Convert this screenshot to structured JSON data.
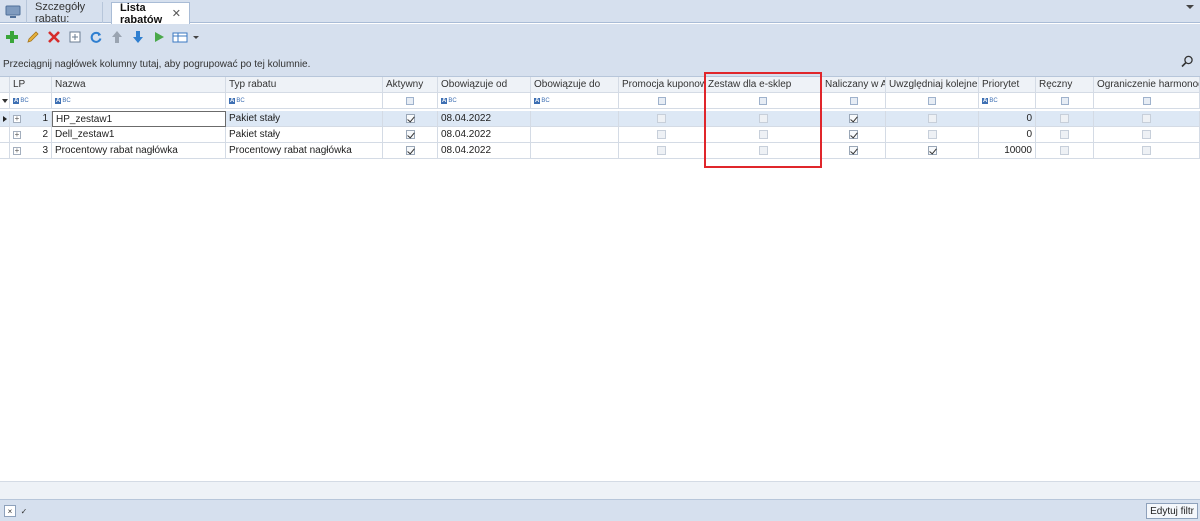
{
  "tabs": [
    {
      "label": "Szczegóły rabatu:",
      "active": false
    },
    {
      "label": "Lista rabatów",
      "active": true,
      "closable": true
    }
  ],
  "toolbar": {
    "icons": [
      "add-icon",
      "edit-icon",
      "delete-icon",
      "document-icon",
      "refresh-icon",
      "move-up-icon",
      "move-down-icon",
      "play-icon",
      "grid-options-icon"
    ]
  },
  "grouppanel": {
    "hint": "Przeciągnij nagłówek kolumny tutaj, aby pogrupować po tej kolumnie."
  },
  "grid": {
    "columns": {
      "lp": "LP",
      "nazwa": "Nazwa",
      "typ": "Typ rabatu",
      "aktywny": "Aktywny",
      "od": "Obowiązuje od",
      "do": "Obowiązuje do",
      "promo": "Promocja kuponowa",
      "zestaw": "Zestaw dla e-sklep",
      "naliczany": "Naliczany w Al...",
      "uwzgl": "Uwzględniaj kolejne r...",
      "priorytet": "Priorytet",
      "reczny": "Ręczny",
      "ogr": "Ograniczenie harmonogr..."
    },
    "filter_text_badge": "BC",
    "rows": [
      {
        "lp": "1",
        "nazwa": "HP_zestaw1",
        "typ": "Pakiet stały",
        "aktywny": true,
        "od": "08.04.2022",
        "do": "",
        "promo": false,
        "zestaw": false,
        "naliczany": true,
        "uwzgl": false,
        "priorytet": "0",
        "reczny": false,
        "ogr": false
      },
      {
        "lp": "2",
        "nazwa": "Dell_zestaw1",
        "typ": "Pakiet stały",
        "aktywny": true,
        "od": "08.04.2022",
        "do": "",
        "promo": false,
        "zestaw": false,
        "naliczany": true,
        "uwzgl": false,
        "priorytet": "0",
        "reczny": false,
        "ogr": false
      },
      {
        "lp": "3",
        "nazwa": "Procentowy rabat nagłówka",
        "typ": "Procentowy rabat nagłówka",
        "aktywny": true,
        "od": "08.04.2022",
        "do": "",
        "promo": false,
        "zestaw": false,
        "naliczany": true,
        "uwzgl": true,
        "priorytet": "10000",
        "reczny": false,
        "ogr": false
      }
    ]
  },
  "footer": {
    "edit_filter_label": "Edytuj filtr",
    "close_symbol": "×",
    "check_symbol": "✓"
  },
  "colors": {
    "chrome": "#d6e0ee",
    "selected_row": "#dde8f5",
    "highlight_box": "#e0262b"
  }
}
